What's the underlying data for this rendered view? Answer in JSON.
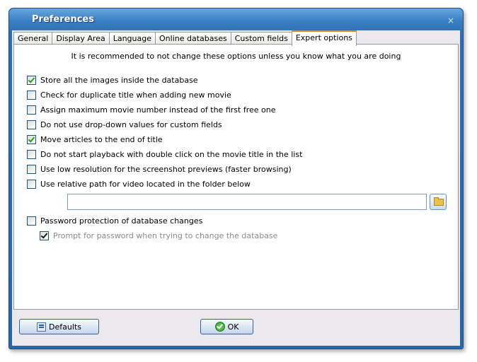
{
  "window": {
    "title": "Preferences",
    "close_glyph": "×"
  },
  "tabs": [
    {
      "label": "General"
    },
    {
      "label": "Display Area"
    },
    {
      "label": "Language"
    },
    {
      "label": "Online databases"
    },
    {
      "label": "Custom fields"
    },
    {
      "label": "Expert options",
      "active": true
    }
  ],
  "notice": "It is recommended to not change these options unless you know what you are doing",
  "options": [
    {
      "label": "Store all the images inside the database",
      "checked": true
    },
    {
      "label": "Check for duplicate title when adding new movie",
      "checked": false
    },
    {
      "label": "Assign maximum movie number instead of the first free one",
      "checked": false
    },
    {
      "label": "Do not use drop-down values for custom fields",
      "checked": false
    },
    {
      "label": "Move articles to the end of title",
      "checked": true
    },
    {
      "label": "Do not start playback with double click on the movie title in the list",
      "checked": false
    },
    {
      "label": "Use low resolution for the screenshot previews (faster browsing)",
      "checked": false
    },
    {
      "label": "Use relative path for video located in the folder below",
      "checked": false
    },
    {
      "label": "Password protection of database changes",
      "checked": false
    },
    {
      "label": "Prompt for password when trying to change the database",
      "checked": true,
      "disabled": true
    }
  ],
  "folder_path": {
    "value": ""
  },
  "buttons": {
    "defaults": "Defaults",
    "ok": "OK"
  }
}
